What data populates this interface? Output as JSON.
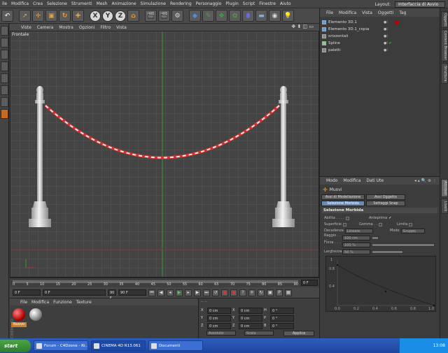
{
  "menubar": {
    "items": [
      "ile",
      "Modifica",
      "Crea",
      "Selezione",
      "Strumenti",
      "Mesh",
      "Animazione",
      "Simulazione",
      "Rendering",
      "Personaggio",
      "Plugin",
      "Script",
      "Finestre",
      "Aiuto"
    ],
    "layout_label": "Layout:",
    "layout_value": "Interfaccia di Avvio"
  },
  "toolbar": {
    "axis_x": "X",
    "axis_y": "Y",
    "axis_z": "Z"
  },
  "viewport": {
    "menu": [
      "Viste",
      "Camera",
      "Mostra",
      "Opzioni",
      "Filtro",
      "Vista"
    ],
    "label": "Frontale",
    "nav_icons": "✥ ⬍ ◫ ▭"
  },
  "timeline": {
    "ticks": [
      "0",
      "5",
      "10",
      "15",
      "20",
      "25",
      "30",
      "35",
      "40",
      "45",
      "50",
      "55",
      "60",
      "65",
      "70",
      "75",
      "80",
      "85",
      "90"
    ],
    "frame": "0 F"
  },
  "playbar": {
    "start": "0 F",
    "current": "0 F",
    "end_left": "90 F",
    "end": "90 F"
  },
  "materials": {
    "menu": [
      "File",
      "Modifica",
      "Funzione",
      "Texture"
    ],
    "mat_label": "Nuovo",
    "brand": "CINEMA 4D"
  },
  "coords": {
    "header": "-- --",
    "rows": [
      {
        "a": "X",
        "av": "0 cm",
        "b": "X",
        "bv": "0 cm",
        "c": "H",
        "cv": "0 °"
      },
      {
        "a": "Y",
        "av": "0 cm",
        "b": "Y",
        "bv": "0 cm",
        "c": "P",
        "cv": "0 °"
      },
      {
        "a": "Z",
        "av": "0 cm",
        "b": "Z",
        "bv": "0 cm",
        "c": "B",
        "cv": "0 °"
      }
    ],
    "mode": "Assoluto",
    "size_mode": "Scala",
    "apply": "Applica"
  },
  "objects": {
    "menu": [
      "File",
      "Modifica",
      "Vista",
      "Oggetti",
      "Tag"
    ],
    "items": [
      {
        "name": "Elemento 3D.1",
        "icon_color": "#5aa0e0"
      },
      {
        "name": "Elemento 3D.1_copia",
        "icon_color": "#5aa0e0"
      },
      {
        "name": "orizzontali",
        "icon_color": "#aaaaaa"
      },
      {
        "name": "Spline",
        "icon_color": "#88cc88"
      },
      {
        "name": "paletti",
        "icon_color": "#aaaaaa"
      }
    ]
  },
  "attributes": {
    "menu": [
      "Modo",
      "Modifica",
      "Dati Ute"
    ],
    "title": "Muovi",
    "tabs": [
      "Assi di Modellazione",
      "Assi Oggetto",
      "Selezione Morbida",
      "Settaggi Snap"
    ],
    "section": "Selezione Morbida",
    "props": {
      "abilita": "Abilita . . . .",
      "anteprima": "Anteprima",
      "superficie": "Superficie",
      "gomma": "Gomma . .",
      "limita": "Limita",
      "decadenza": "Decadenza",
      "decadenza_val": "Lineare",
      "modo": "Modo",
      "modo_val": "Gruppo",
      "raggio": "Raggio . . . .",
      "raggio_val": "100 cm",
      "forza": "Forza . . . .",
      "forza_val": "100 %",
      "larghezza": "Larghezza",
      "larghezza_val": "50 %"
    },
    "graph_y": [
      "1",
      "0.8",
      "0.4"
    ],
    "graph_x": [
      "0.0",
      "0.2",
      "0.4",
      "0.6",
      "0.8",
      "1.0"
    ]
  },
  "side_tabs": [
    "Oggetti",
    "Content Browser",
    "Struttura",
    "Attributi",
    "Livelli"
  ],
  "taskbar": {
    "start": "start",
    "tasks": [
      "Forum - C4Dzone - Ri...",
      "CINEMA 4D R13.061",
      "Documenti"
    ],
    "time": "13:08"
  },
  "colors": {
    "chain_red": "#d33030",
    "axis_green": "#2e9e2e",
    "axis_red": "#b03030",
    "selected_tab": "#6a8ab8"
  }
}
